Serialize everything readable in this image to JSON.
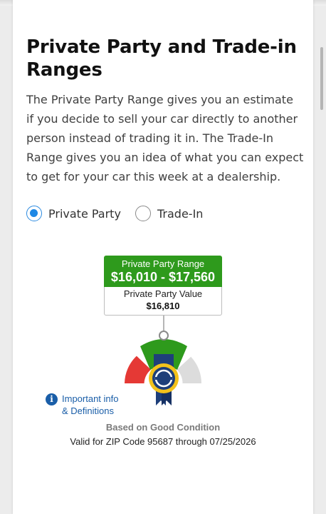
{
  "section": {
    "title": "Private Party and Trade-in Ranges",
    "description": "The Private Party Range gives you an estimate if you decide to sell your car directly to another person instead of trading it in. The Trade-In Range gives you an idea of what you can expect to get for your car this week at a dealership."
  },
  "options": {
    "private_party": {
      "label": "Private Party",
      "selected": true
    },
    "trade_in": {
      "label": "Trade-In",
      "selected": false
    }
  },
  "range": {
    "label": "Private Party Range",
    "value": "$16,010 - $17,560"
  },
  "value": {
    "label": "Private Party Value",
    "amount": "$16,810"
  },
  "gauge": {
    "colors": {
      "low": "#e53935",
      "mid": "#2e9a1c",
      "high": "#d9d9d9"
    },
    "icon": "kbb-ribbon-badge-icon"
  },
  "info": {
    "icon": "info-icon",
    "line1": "Important info",
    "line2": "& Definitions"
  },
  "condition": "Based on Good Condition",
  "validity": "Valid for ZIP Code 95687 through 07/25/2026",
  "colors": {
    "accent_blue": "#1e88e5",
    "link_blue": "#1a5ea8",
    "range_green": "#2e9a1c"
  }
}
